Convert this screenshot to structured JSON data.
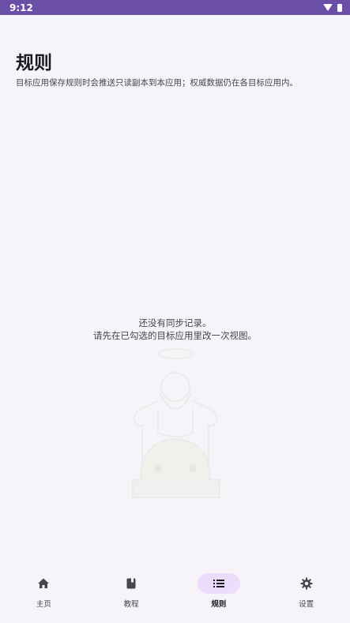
{
  "status_bar": {
    "time": "9:12",
    "wifi_icon": "wifi-icon",
    "battery_icon": "battery-icon"
  },
  "header": {
    "title": "规则",
    "subtitle": "目标应用保存规则时会推送只读副本到本应用；权威数据仍在各目标应用内。"
  },
  "empty_state": {
    "line1": "还没有同步记录。",
    "line2": "请先在已勾选的目标应用里改一次视图。",
    "illustration": "android-angel-illustration"
  },
  "bottom_nav": {
    "items": [
      {
        "label": "主页",
        "icon": "home-icon",
        "active": false
      },
      {
        "label": "教程",
        "icon": "book-icon",
        "active": false
      },
      {
        "label": "规则",
        "icon": "list-icon",
        "active": true
      },
      {
        "label": "设置",
        "icon": "gear-icon",
        "active": false
      }
    ]
  },
  "colors": {
    "status_bar": "#6b4fa6",
    "background": "#f6f3f9",
    "active_pill": "#ecddfc",
    "text_primary": "#1c1b1f",
    "text_secondary": "#49454f"
  }
}
